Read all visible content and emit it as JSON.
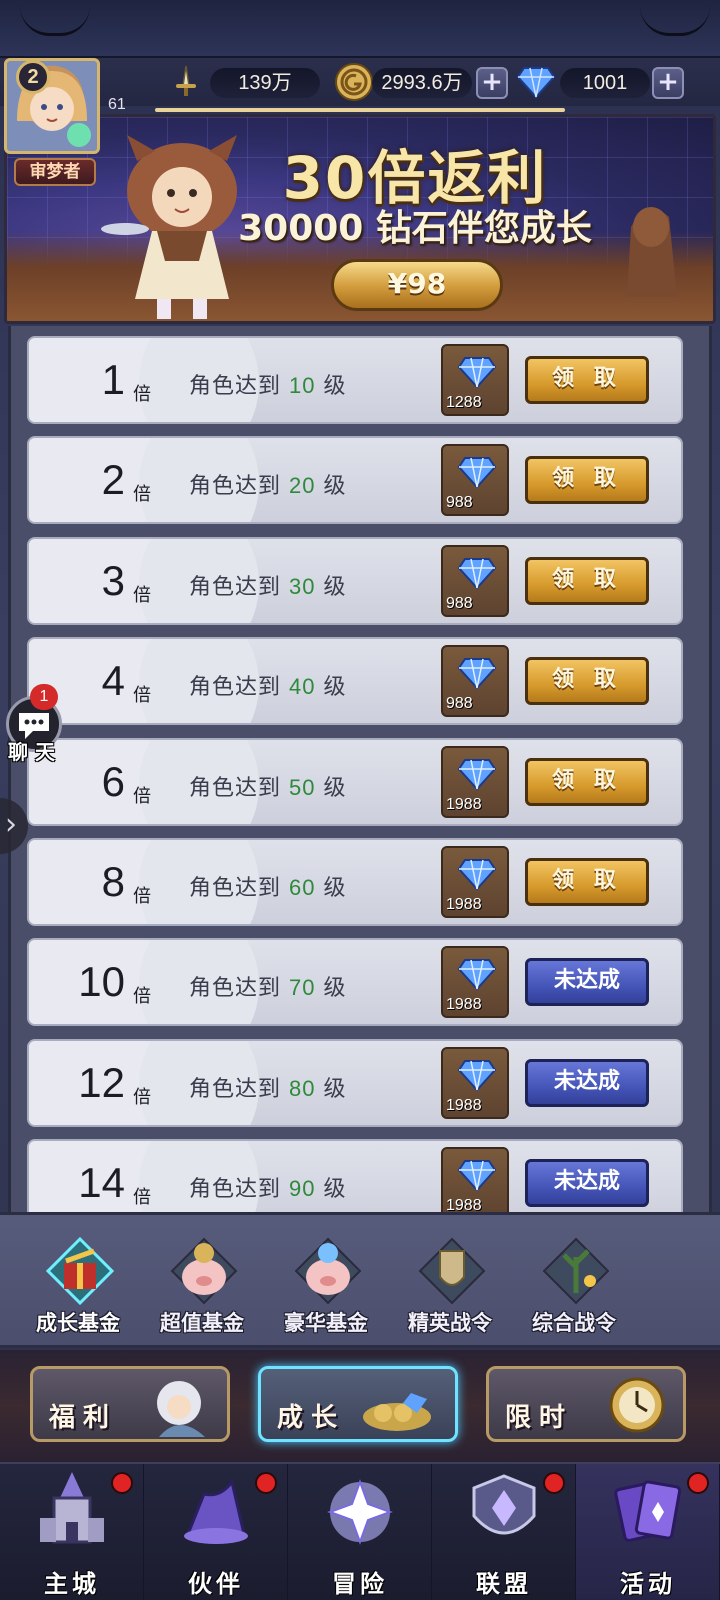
{
  "resources": {
    "power": "139万",
    "gold": "2993.6万",
    "diamonds": "1001"
  },
  "player": {
    "level": "2",
    "exp": "61",
    "title": "审梦者",
    "exp_progress": 1.0
  },
  "banner": {
    "title": "30倍返利",
    "subtitle": "30000 钻石伴您成长",
    "price": "¥98"
  },
  "rows": [
    {
      "mult": "1",
      "unit": "倍",
      "cond_prefix": "角色达到",
      "level": "10",
      "cond_suffix": "级",
      "qty": "1288",
      "action": "领  取",
      "state": "claimable"
    },
    {
      "mult": "2",
      "unit": "倍",
      "cond_prefix": "角色达到",
      "level": "20",
      "cond_suffix": "级",
      "qty": "988",
      "action": "领  取",
      "state": "claimable"
    },
    {
      "mult": "3",
      "unit": "倍",
      "cond_prefix": "角色达到",
      "level": "30",
      "cond_suffix": "级",
      "qty": "988",
      "action": "领  取",
      "state": "claimable"
    },
    {
      "mult": "4",
      "unit": "倍",
      "cond_prefix": "角色达到",
      "level": "40",
      "cond_suffix": "级",
      "qty": "988",
      "action": "领  取",
      "state": "claimable"
    },
    {
      "mult": "6",
      "unit": "倍",
      "cond_prefix": "角色达到",
      "level": "50",
      "cond_suffix": "级",
      "qty": "1988",
      "action": "领  取",
      "state": "claimable"
    },
    {
      "mult": "8",
      "unit": "倍",
      "cond_prefix": "角色达到",
      "level": "60",
      "cond_suffix": "级",
      "qty": "1988",
      "action": "领  取",
      "state": "claimable"
    },
    {
      "mult": "10",
      "unit": "倍",
      "cond_prefix": "角色达到",
      "level": "70",
      "cond_suffix": "级",
      "qty": "1988",
      "action": "未达成",
      "state": "pending"
    },
    {
      "mult": "12",
      "unit": "倍",
      "cond_prefix": "角色达到",
      "level": "80",
      "cond_suffix": "级",
      "qty": "1988",
      "action": "未达成",
      "state": "pending"
    },
    {
      "mult": "14",
      "unit": "倍",
      "cond_prefix": "角色达到",
      "level": "90",
      "cond_suffix": "级",
      "qty": "1988",
      "action": "未达成",
      "state": "pending"
    }
  ],
  "chat": {
    "label": "聊 天",
    "badge": "1"
  },
  "fund_tabs": [
    {
      "label": "成长基金",
      "active": true
    },
    {
      "label": "超值基金",
      "active": false
    },
    {
      "label": "豪华基金",
      "active": false
    },
    {
      "label": "精英战令",
      "active": false
    },
    {
      "label": "综合战令",
      "active": false
    }
  ],
  "category_tabs": [
    {
      "label": "福利",
      "active": false
    },
    {
      "label": "成长",
      "active": true
    },
    {
      "label": "限时",
      "active": false
    }
  ],
  "nav": [
    {
      "label": "主城",
      "active": false,
      "badge": true
    },
    {
      "label": "伙伴",
      "active": false,
      "badge": true
    },
    {
      "label": "冒险",
      "active": false,
      "badge": false
    },
    {
      "label": "联盟",
      "active": false,
      "badge": true
    },
    {
      "label": "活动",
      "active": true,
      "badge": true
    }
  ],
  "colors": {
    "claim_gold": "#d69a2c",
    "pending_blue": "#4555b8",
    "level_green": "#2e8a3a",
    "nav_badge_red": "#e02424"
  }
}
